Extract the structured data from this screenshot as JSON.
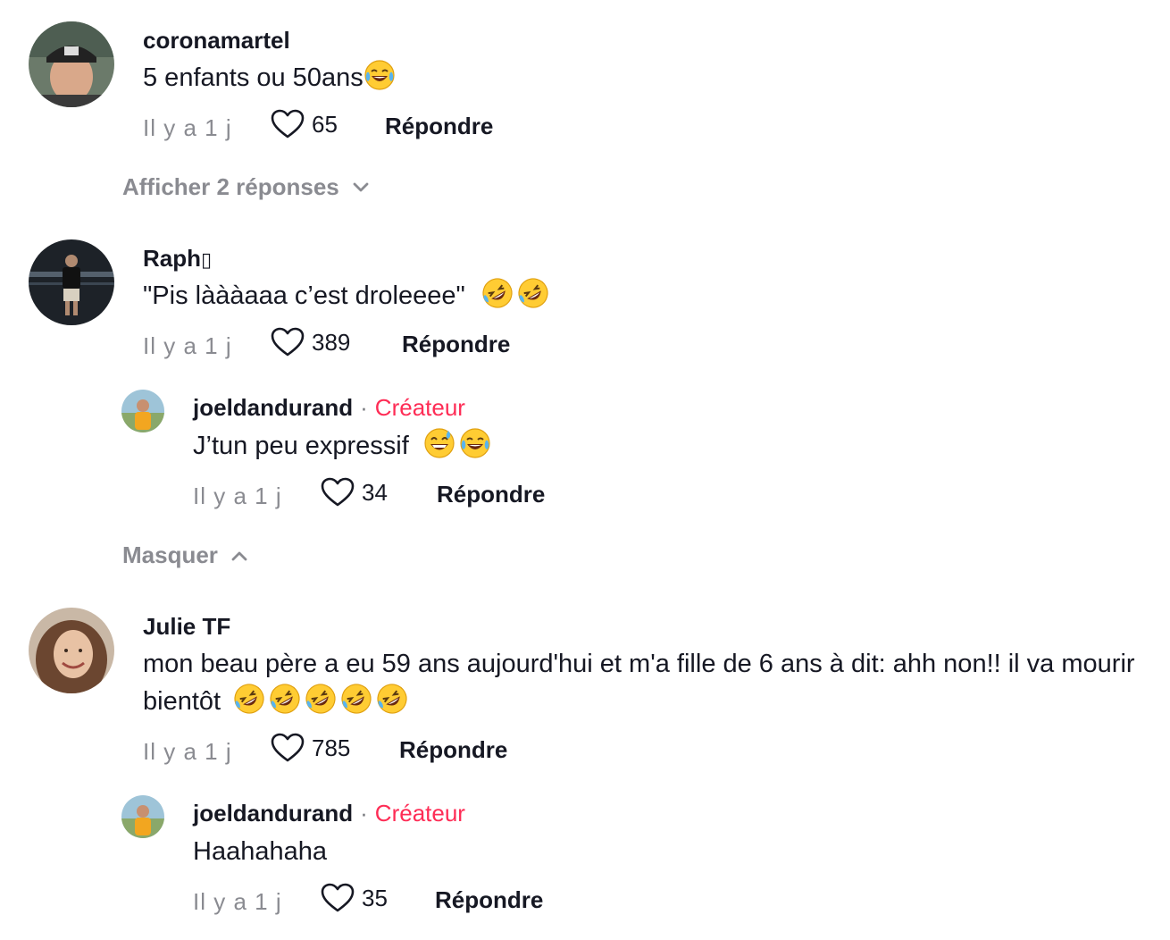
{
  "comments": [
    {
      "username": "coronamartel",
      "text": "5 enfants ou 50ans",
      "time": "Il y a 1 j",
      "likes": "65",
      "reply_label": "Répondre",
      "toggle_label": "Afficher 2 réponses"
    },
    {
      "username": "Raph",
      "username_glyph": "▯",
      "text": "\"Pis làààaaa c’est droleeee\"",
      "time": "Il y a 1 j",
      "likes": "389",
      "reply_label": "Répondre",
      "toggle_label": "Masquer",
      "replies": [
        {
          "username": "joeldandurand",
          "separator": "·",
          "creator_label": "Créateur",
          "text": "J’tun peu expressif",
          "time": "Il y a 1 j",
          "likes": "34",
          "reply_label": "Répondre"
        }
      ]
    },
    {
      "username": "Julie TF",
      "text": "mon beau père a eu 59 ans aujourd'hui et m'a fille de 6 ans à dit: ahh non!! il va mourir bientôt",
      "time": "Il y a 1 j",
      "likes": "785",
      "reply_label": "Répondre",
      "replies": [
        {
          "username": "joeldandurand",
          "separator": "·",
          "creator_label": "Créateur",
          "text": "Haahahaha",
          "time": "Il y a 1 j",
          "likes": "35",
          "reply_label": "Répondre"
        }
      ]
    }
  ],
  "icons": {
    "like": "heart-outline-icon",
    "expand": "chevron-down-icon",
    "collapse": "chevron-up-icon",
    "emoji_laugh": "face-with-tears-of-joy-emoji",
    "emoji_rofl": "rolling-on-floor-laughing-emoji",
    "emoji_sweat": "grinning-face-with-sweat-emoji"
  },
  "colors": {
    "creator": "#fe2c55",
    "muted": "#8a8b91",
    "text": "#161823"
  }
}
